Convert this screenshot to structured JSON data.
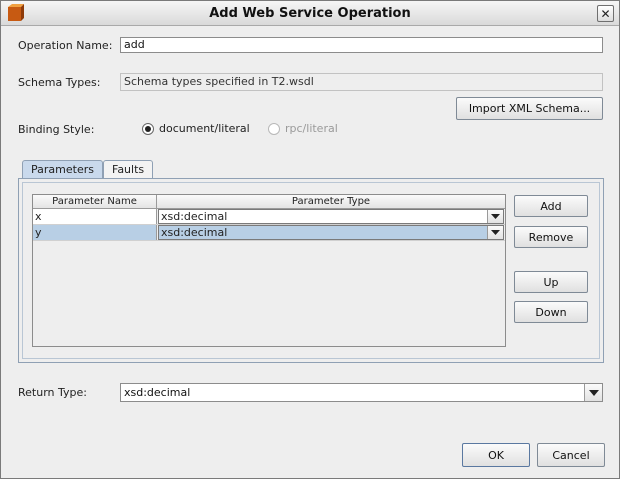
{
  "window": {
    "title": "Add Web Service Operation",
    "close_label": "✕"
  },
  "form": {
    "operation_name_label": "Operation Name:",
    "operation_name_value": "add",
    "schema_types_label": "Schema Types:",
    "schema_types_value": "Schema types specified in T2.wsdl",
    "import_button": "Import XML Schema...",
    "binding_style_label": "Binding Style:",
    "binding_options": [
      {
        "label": "document/literal",
        "selected": true,
        "enabled": true
      },
      {
        "label": "rpc/literal",
        "selected": false,
        "enabled": false
      }
    ],
    "return_type_label": "Return Type:",
    "return_type_value": "xsd:decimal"
  },
  "tabs": [
    {
      "label": "Parameters",
      "active": true
    },
    {
      "label": "Faults",
      "active": false
    }
  ],
  "parameters_table": {
    "columns": [
      "Parameter Name",
      "Parameter Type"
    ],
    "rows": [
      {
        "name": "x",
        "type": "xsd:decimal",
        "selected": false
      },
      {
        "name": "y",
        "type": "xsd:decimal",
        "selected": true
      }
    ]
  },
  "param_buttons": {
    "add": "Add",
    "remove": "Remove",
    "up": "Up",
    "down": "Down"
  },
  "footer": {
    "ok": "OK",
    "cancel": "Cancel"
  }
}
